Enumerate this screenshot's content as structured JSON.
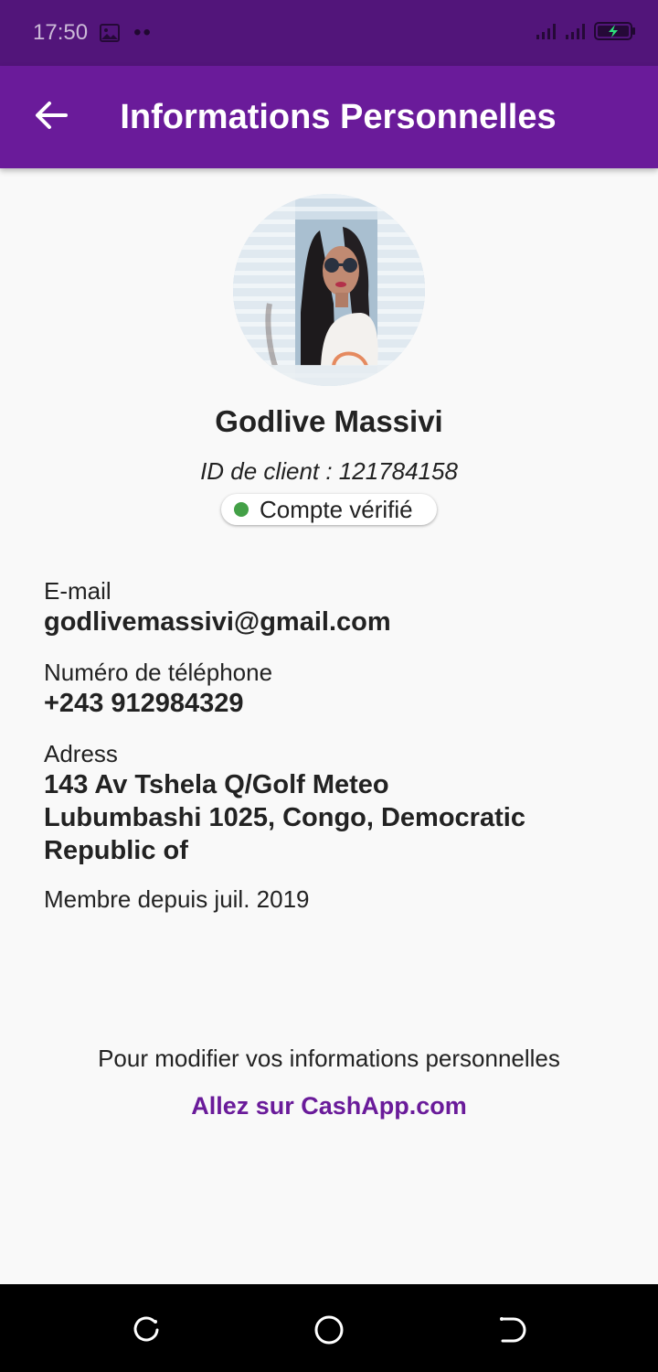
{
  "status_bar": {
    "time": "17:50",
    "icons": [
      "image-icon",
      "dots-icon",
      "signal-icon",
      "signal-icon",
      "battery-charging-icon"
    ]
  },
  "app_bar": {
    "title": "Informations Personnelles",
    "back_icon": "arrow-left-icon"
  },
  "profile": {
    "name": "Godlive Massivi",
    "client_id": "ID de client : 121784158",
    "verified_label": "Compte vérifié"
  },
  "fields": {
    "email_label": "E-mail",
    "email_value": "godlivemassivi@gmail.com",
    "phone_label": "Numéro de téléphone",
    "phone_value": "+243 912984329",
    "address_label": "Adress",
    "address_line1": "143 Av Tshela Q/Golf Meteo",
    "address_line2": "Lubumbashi 1025, Congo, Democratic",
    "address_line3": "Republic of",
    "member_since": "Membre depuis juil. 2019"
  },
  "footer": {
    "hint": "Pour modifier vos informations personnelles",
    "link": "Allez sur CashApp.com"
  },
  "colors": {
    "status_bar": "#52157a",
    "app_bar": "#6a1b9a",
    "accent": "#6a1b9a",
    "verified": "#43a047",
    "background": "#f9f9f9"
  },
  "nav_bar": {
    "buttons": [
      "recent-apps-icon",
      "home-icon",
      "back-icon"
    ]
  }
}
